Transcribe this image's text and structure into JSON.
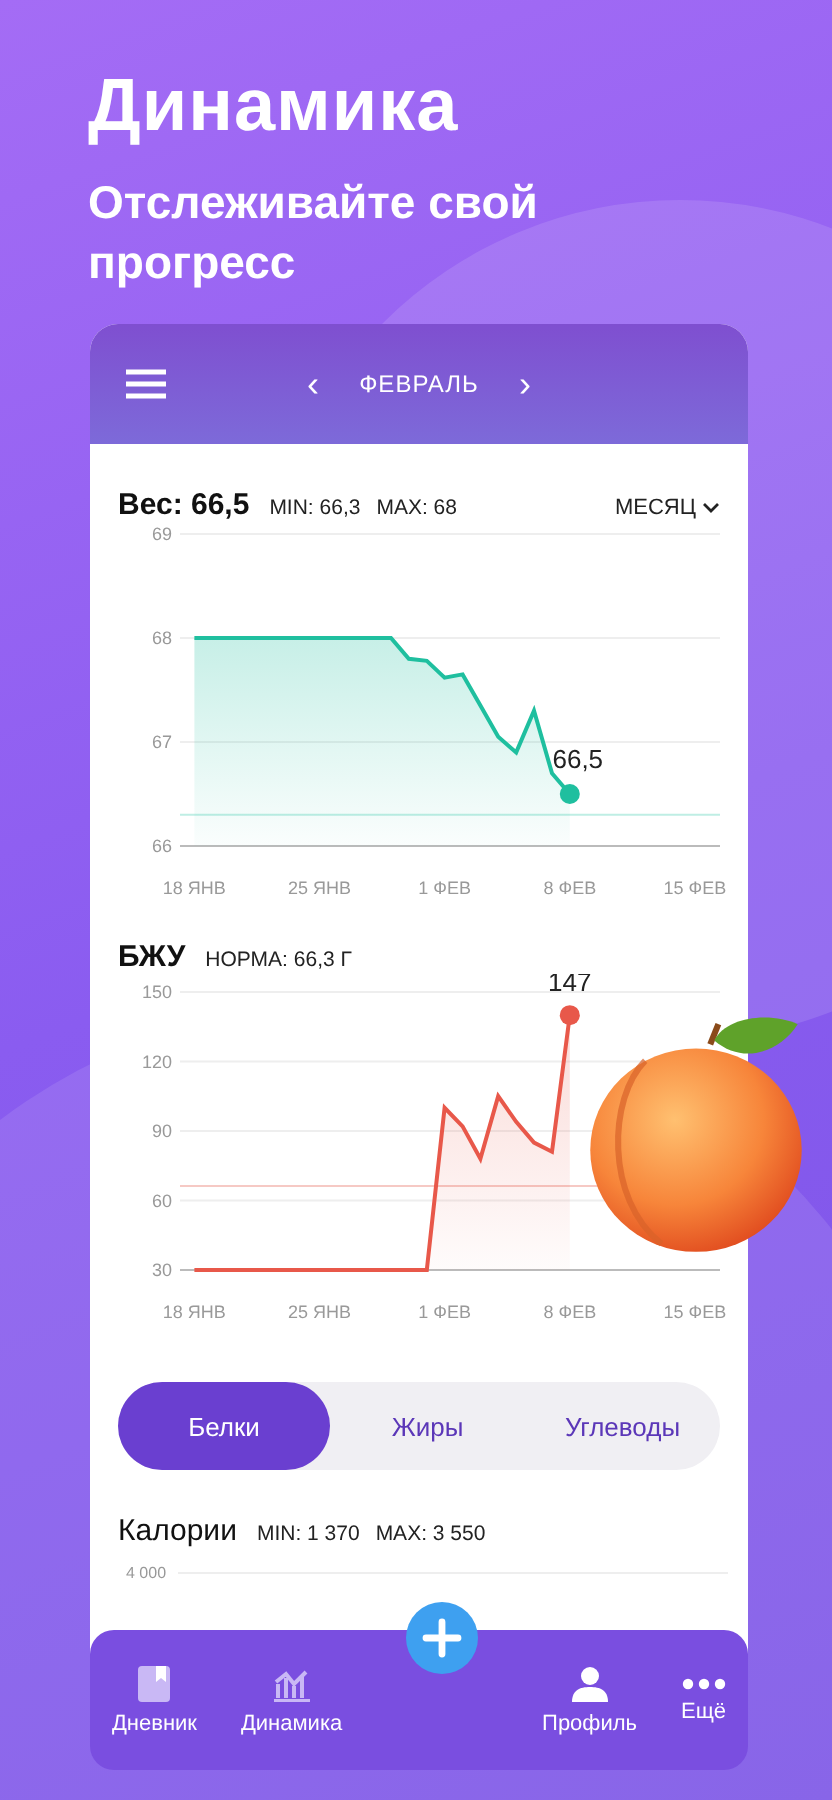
{
  "headline": "Динамика",
  "subtitle": "Отслеживайте свой прогресс",
  "app_header": {
    "month": "ФЕВРАЛЬ",
    "prev": "‹",
    "next": "›"
  },
  "weight": {
    "title": "Вес: 66,5",
    "min": "MIN: 66,3",
    "max": "MAX: 68",
    "period": "МЕСЯЦ",
    "chart_data": {
      "type": "area",
      "ylim": [
        66,
        69
      ],
      "yticks": [
        66,
        67,
        68,
        69
      ],
      "categories": [
        "18 ЯНВ",
        null,
        null,
        null,
        null,
        null,
        null,
        "25 ЯНВ",
        null,
        null,
        null,
        null,
        null,
        null,
        "1 ФЕВ",
        null,
        null,
        null,
        null,
        null,
        null,
        "8 ФЕВ",
        null,
        null,
        null,
        null,
        null,
        null,
        "15 ФЕВ"
      ],
      "series": [
        {
          "color": "#1fbf9f",
          "values": [
            68,
            68,
            68,
            68,
            68,
            68,
            68,
            68,
            68,
            68,
            68,
            68,
            67.8,
            67.78,
            67.62,
            67.65,
            67.35,
            67.05,
            66.9,
            67.3,
            66.7,
            66.5,
            null,
            null,
            null,
            null,
            null,
            null,
            null
          ]
        }
      ],
      "annotations": [
        {
          "x": "8 ФЕВ",
          "y": 66.5,
          "text": "66,5"
        }
      ],
      "ref_lines": [
        {
          "axis": "y",
          "value": 66.3,
          "color": "#bfeee4"
        }
      ],
      "grid": true
    }
  },
  "macros": {
    "title": "БЖУ",
    "norm": "НОРМА: 66,3 Г",
    "chart_data": {
      "type": "area",
      "ylim": [
        30,
        150
      ],
      "yticks": [
        30,
        60,
        90,
        120,
        150
      ],
      "categories": [
        "18 ЯНВ",
        null,
        null,
        null,
        null,
        null,
        null,
        "25 ЯНВ",
        null,
        null,
        null,
        null,
        null,
        null,
        "1 ФЕВ",
        null,
        null,
        null,
        null,
        null,
        null,
        "8 ФЕВ",
        null,
        null,
        null,
        null,
        null,
        null,
        "15 ФЕВ"
      ],
      "series": [
        {
          "color": "#e8584a",
          "values": [
            30,
            30,
            30,
            30,
            30,
            30,
            30,
            30,
            30,
            30,
            30,
            30,
            30,
            30,
            100,
            92,
            78,
            105,
            94,
            85,
            81,
            140,
            null,
            null,
            null,
            null,
            null,
            null,
            null
          ]
        }
      ],
      "annotations": [
        {
          "x": "8 ФЕВ",
          "y": 140,
          "text": "147"
        }
      ],
      "ref_lines": [
        {
          "axis": "y",
          "value": 66.3,
          "color": "#f6c9c4"
        }
      ],
      "grid": true
    }
  },
  "macro_tabs": [
    {
      "label": "Белки",
      "selected": true
    },
    {
      "label": "Жиры",
      "selected": false
    },
    {
      "label": "Углеводы",
      "selected": false
    }
  ],
  "calories": {
    "title": "Калории",
    "min": "MIN: 1 370",
    "max": "MAX: 3 550",
    "axis_label": "4 000"
  },
  "nav": [
    {
      "kind": "diary",
      "label": "Дневник"
    },
    {
      "kind": "stats",
      "label": "Динамика"
    },
    {
      "kind": "add"
    },
    {
      "kind": "profile",
      "label": "Профиль"
    },
    {
      "kind": "more",
      "label": "Ещё"
    }
  ]
}
